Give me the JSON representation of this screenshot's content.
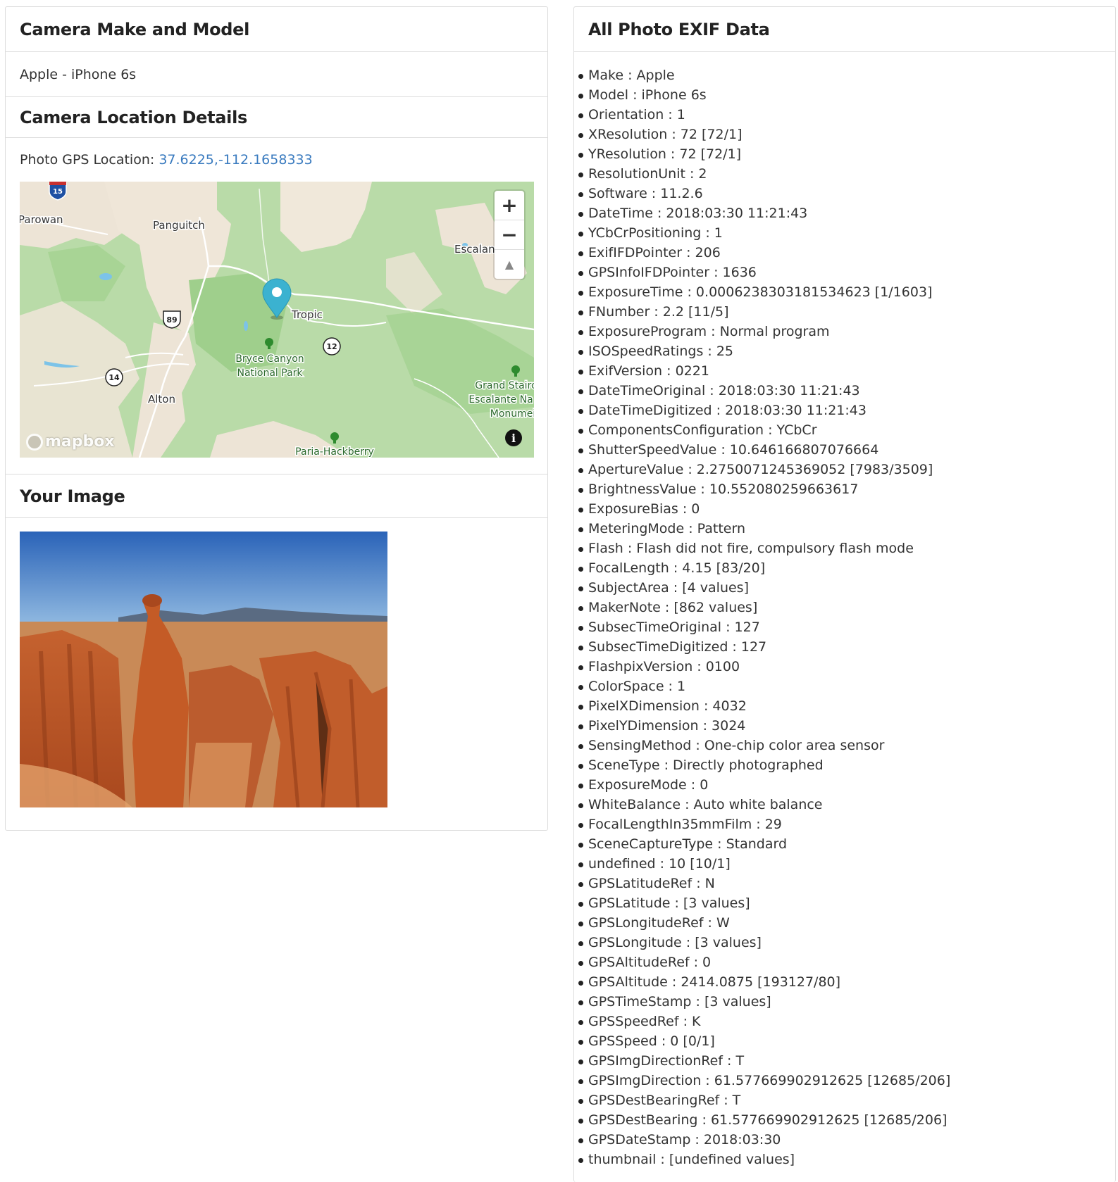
{
  "camera": {
    "heading": "Camera Make and Model",
    "make_model": "Apple - iPhone 6s"
  },
  "location": {
    "heading": "Camera Location Details",
    "gps_label": "Photo GPS Location: ",
    "gps_value": "37.6225,-112.1658333"
  },
  "map": {
    "zoom_in": "+",
    "zoom_out": "−",
    "compass": "▲",
    "attribution": "mapbox",
    "info": "i",
    "labels": {
      "parowan": "Parowan",
      "panguitch": "Panguitch",
      "escalante": "Escalant",
      "tropic": "Tropic",
      "bryce1": "Bryce Canyon",
      "bryce2": "National Park",
      "alton": "Alton",
      "grand1": "Grand Stairc",
      "grand2": "Escalante Na",
      "grand3": "Monumei",
      "paria": "Paria-Hackberry",
      "i15": "15",
      "us89": "89",
      "r12": "12",
      "r14": "14"
    }
  },
  "image_section": {
    "heading": "Your Image"
  },
  "exif": {
    "heading": "All Photo EXIF Data",
    "items": [
      "Make : Apple",
      "Model : iPhone 6s",
      "Orientation : 1",
      "XResolution : 72 [72/1]",
      "YResolution : 72 [72/1]",
      "ResolutionUnit : 2",
      "Software : 11.2.6",
      "DateTime : 2018:03:30 11:21:43",
      "YCbCrPositioning : 1",
      "ExifIFDPointer : 206",
      "GPSInfoIFDPointer : 1636",
      "ExposureTime : 0.0006238303181534623 [1/1603]",
      "FNumber : 2.2 [11/5]",
      "ExposureProgram : Normal program",
      "ISOSpeedRatings : 25",
      "ExifVersion : 0221",
      "DateTimeOriginal : 2018:03:30 11:21:43",
      "DateTimeDigitized : 2018:03:30 11:21:43",
      "ComponentsConfiguration : YCbCr",
      "ShutterSpeedValue : 10.646166807076664",
      "ApertureValue : 2.2750071245369052 [7983/3509]",
      "BrightnessValue : 10.552080259663617",
      "ExposureBias : 0",
      "MeteringMode : Pattern",
      "Flash : Flash did not fire, compulsory flash mode",
      "FocalLength : 4.15 [83/20]",
      "SubjectArea : [4 values]",
      "MakerNote : [862 values]",
      "SubsecTimeOriginal : 127",
      "SubsecTimeDigitized : 127",
      "FlashpixVersion : 0100",
      "ColorSpace : 1",
      "PixelXDimension : 4032",
      "PixelYDimension : 3024",
      "SensingMethod : One-chip color area sensor",
      "SceneType : Directly photographed",
      "ExposureMode : 0",
      "WhiteBalance : Auto white balance",
      "FocalLengthIn35mmFilm : 29",
      "SceneCaptureType : Standard",
      "undefined : 10 [10/1]",
      "GPSLatitudeRef : N",
      "GPSLatitude : [3 values]",
      "GPSLongitudeRef : W",
      "GPSLongitude : [3 values]",
      "GPSAltitudeRef : 0",
      "GPSAltitude : 2414.0875 [193127/80]",
      "GPSTimeStamp : [3 values]",
      "GPSSpeedRef : K",
      "GPSSpeed : 0 [0/1]",
      "GPSImgDirectionRef : T",
      "GPSImgDirection : 61.577669902912625 [12685/206]",
      "GPSDestBearingRef : T",
      "GPSDestBearing : 61.577669902912625 [12685/206]",
      "GPSDateStamp : 2018:03:30",
      "thumbnail : [undefined values]"
    ]
  },
  "colors": {
    "link": "#3a7bbf",
    "marker": "#3bb2d0",
    "park_green": "#2e8b2e"
  }
}
